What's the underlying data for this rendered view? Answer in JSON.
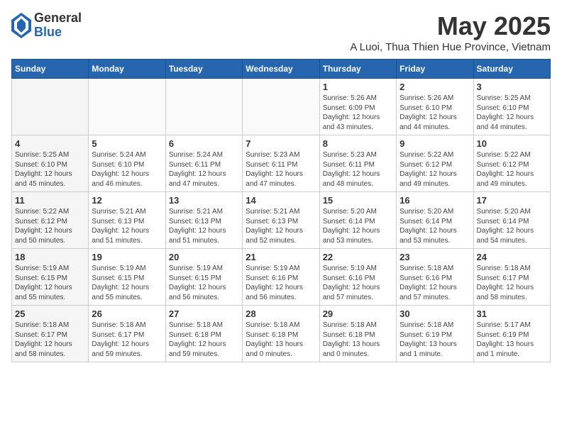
{
  "logo": {
    "general": "General",
    "blue": "Blue"
  },
  "header": {
    "month": "May 2025",
    "location": "A Luoi, Thua Thien Hue Province, Vietnam"
  },
  "days_of_week": [
    "Sunday",
    "Monday",
    "Tuesday",
    "Wednesday",
    "Thursday",
    "Friday",
    "Saturday"
  ],
  "weeks": [
    [
      {
        "day": "",
        "info": ""
      },
      {
        "day": "",
        "info": ""
      },
      {
        "day": "",
        "info": ""
      },
      {
        "day": "",
        "info": ""
      },
      {
        "day": "1",
        "info": "Sunrise: 5:26 AM\nSunset: 6:09 PM\nDaylight: 12 hours\nand 43 minutes."
      },
      {
        "day": "2",
        "info": "Sunrise: 5:26 AM\nSunset: 6:10 PM\nDaylight: 12 hours\nand 44 minutes."
      },
      {
        "day": "3",
        "info": "Sunrise: 5:25 AM\nSunset: 6:10 PM\nDaylight: 12 hours\nand 44 minutes."
      }
    ],
    [
      {
        "day": "4",
        "info": "Sunrise: 5:25 AM\nSunset: 6:10 PM\nDaylight: 12 hours\nand 45 minutes."
      },
      {
        "day": "5",
        "info": "Sunrise: 5:24 AM\nSunset: 6:10 PM\nDaylight: 12 hours\nand 46 minutes."
      },
      {
        "day": "6",
        "info": "Sunrise: 5:24 AM\nSunset: 6:11 PM\nDaylight: 12 hours\nand 47 minutes."
      },
      {
        "day": "7",
        "info": "Sunrise: 5:23 AM\nSunset: 6:11 PM\nDaylight: 12 hours\nand 47 minutes."
      },
      {
        "day": "8",
        "info": "Sunrise: 5:23 AM\nSunset: 6:11 PM\nDaylight: 12 hours\nand 48 minutes."
      },
      {
        "day": "9",
        "info": "Sunrise: 5:22 AM\nSunset: 6:12 PM\nDaylight: 12 hours\nand 49 minutes."
      },
      {
        "day": "10",
        "info": "Sunrise: 5:22 AM\nSunset: 6:12 PM\nDaylight: 12 hours\nand 49 minutes."
      }
    ],
    [
      {
        "day": "11",
        "info": "Sunrise: 5:22 AM\nSunset: 6:12 PM\nDaylight: 12 hours\nand 50 minutes."
      },
      {
        "day": "12",
        "info": "Sunrise: 5:21 AM\nSunset: 6:13 PM\nDaylight: 12 hours\nand 51 minutes."
      },
      {
        "day": "13",
        "info": "Sunrise: 5:21 AM\nSunset: 6:13 PM\nDaylight: 12 hours\nand 51 minutes."
      },
      {
        "day": "14",
        "info": "Sunrise: 5:21 AM\nSunset: 6:13 PM\nDaylight: 12 hours\nand 52 minutes."
      },
      {
        "day": "15",
        "info": "Sunrise: 5:20 AM\nSunset: 6:14 PM\nDaylight: 12 hours\nand 53 minutes."
      },
      {
        "day": "16",
        "info": "Sunrise: 5:20 AM\nSunset: 6:14 PM\nDaylight: 12 hours\nand 53 minutes."
      },
      {
        "day": "17",
        "info": "Sunrise: 5:20 AM\nSunset: 6:14 PM\nDaylight: 12 hours\nand 54 minutes."
      }
    ],
    [
      {
        "day": "18",
        "info": "Sunrise: 5:19 AM\nSunset: 6:15 PM\nDaylight: 12 hours\nand 55 minutes."
      },
      {
        "day": "19",
        "info": "Sunrise: 5:19 AM\nSunset: 6:15 PM\nDaylight: 12 hours\nand 55 minutes."
      },
      {
        "day": "20",
        "info": "Sunrise: 5:19 AM\nSunset: 6:15 PM\nDaylight: 12 hours\nand 56 minutes."
      },
      {
        "day": "21",
        "info": "Sunrise: 5:19 AM\nSunset: 6:16 PM\nDaylight: 12 hours\nand 56 minutes."
      },
      {
        "day": "22",
        "info": "Sunrise: 5:19 AM\nSunset: 6:16 PM\nDaylight: 12 hours\nand 57 minutes."
      },
      {
        "day": "23",
        "info": "Sunrise: 5:18 AM\nSunset: 6:16 PM\nDaylight: 12 hours\nand 57 minutes."
      },
      {
        "day": "24",
        "info": "Sunrise: 5:18 AM\nSunset: 6:17 PM\nDaylight: 12 hours\nand 58 minutes."
      }
    ],
    [
      {
        "day": "25",
        "info": "Sunrise: 5:18 AM\nSunset: 6:17 PM\nDaylight: 12 hours\nand 58 minutes."
      },
      {
        "day": "26",
        "info": "Sunrise: 5:18 AM\nSunset: 6:17 PM\nDaylight: 12 hours\nand 59 minutes."
      },
      {
        "day": "27",
        "info": "Sunrise: 5:18 AM\nSunset: 6:18 PM\nDaylight: 12 hours\nand 59 minutes."
      },
      {
        "day": "28",
        "info": "Sunrise: 5:18 AM\nSunset: 6:18 PM\nDaylight: 13 hours\nand 0 minutes."
      },
      {
        "day": "29",
        "info": "Sunrise: 5:18 AM\nSunset: 6:18 PM\nDaylight: 13 hours\nand 0 minutes."
      },
      {
        "day": "30",
        "info": "Sunrise: 5:18 AM\nSunset: 6:19 PM\nDaylight: 13 hours\nand 1 minute."
      },
      {
        "day": "31",
        "info": "Sunrise: 5:17 AM\nSunset: 6:19 PM\nDaylight: 13 hours\nand 1 minute."
      }
    ]
  ]
}
